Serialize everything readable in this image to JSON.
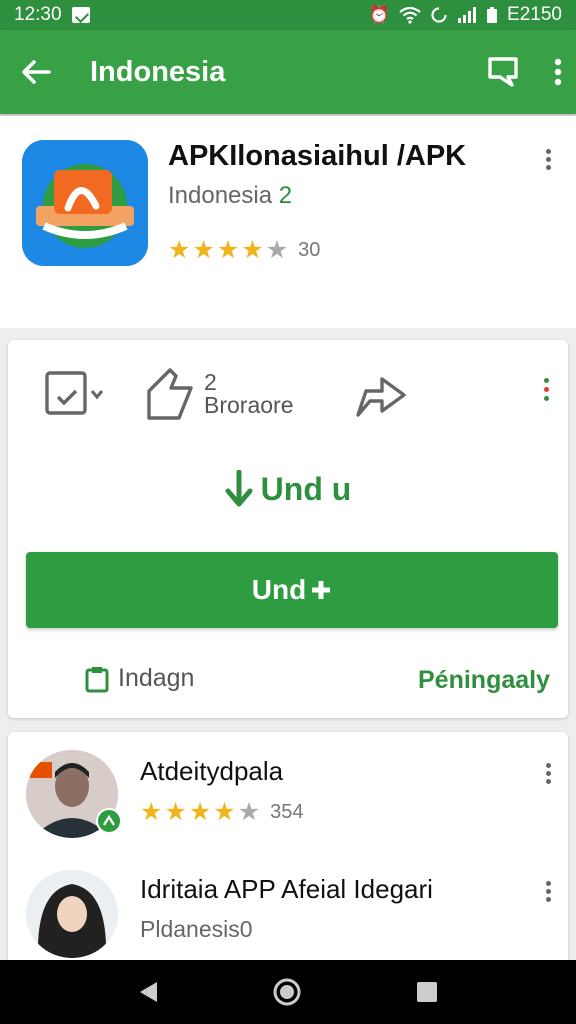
{
  "status_bar": {
    "time": "12:30",
    "right_text": "E2150"
  },
  "app_bar": {
    "title": "Indonesia",
    "icons": [
      "back-arrow-icon",
      "chat-icon",
      "more-vert-icon"
    ]
  },
  "app_header": {
    "name": "APKIlonasiaihul /APK",
    "subtitle_text": "Indonesia",
    "subtitle_number": "2",
    "rating_value": 4.5,
    "rating_count": "30"
  },
  "actions": {
    "wishlist_icon": "wishlist-check-icon",
    "share_count": "2",
    "share_label": "Broraore",
    "forward_icon": "forward-share-icon",
    "install_link_label": "Und u",
    "install_button_label": "Und",
    "footer_left_label": "Indagn",
    "footer_right_label": "Péningaaly"
  },
  "reviews": [
    {
      "name": "Atdeitydpala",
      "rating_value": 4.5,
      "rating_count": "354"
    },
    {
      "name": "Idritaia APP Afeial Idegari",
      "subtitle": "Pldanesis0"
    }
  ],
  "colors": {
    "primary_green": "#38a146",
    "dark_green": "#2e8f3e",
    "star": "#f2b31d"
  }
}
